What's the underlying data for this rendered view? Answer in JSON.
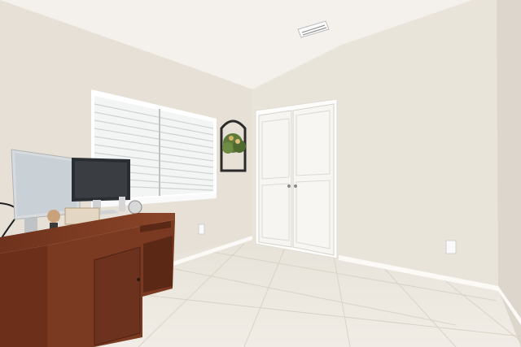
{
  "scene": {
    "kind": "photo",
    "subject": "home-office-room",
    "objects": [
      "vaulted-ceiling",
      "hvac-vent",
      "window-with-blinds",
      "wall-plant-decor",
      "double-closet-door",
      "wooden-desk",
      "monitor-left",
      "monitor-right",
      "tile-floor",
      "baseboard",
      "wall-outlet"
    ]
  },
  "palette": {
    "wall": "#e7e2d8",
    "wall_shadow": "#ddd6cb",
    "ceiling": "#f2efe9",
    "floor": "#ece7dd",
    "tile_lines": "#d9d2c6",
    "door": "#f7f6f2",
    "trim": "#ffffff",
    "desk": "#7a3a22",
    "desk_dark": "#5b2816",
    "monitor_frame": "#d9dcdf",
    "monitor_screen": "#cfd6dc",
    "monitor_dark": "#2a2d31"
  }
}
